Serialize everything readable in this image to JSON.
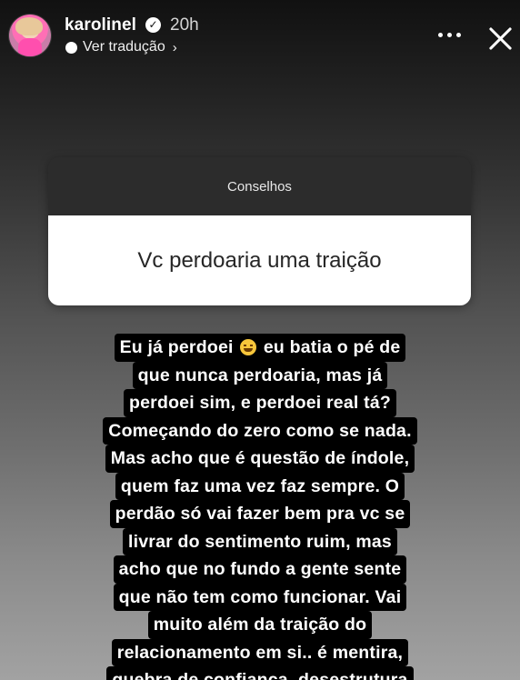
{
  "header": {
    "username": "karolinel",
    "time": "20h",
    "translate_label": "Ver tradução",
    "verified_glyph": "✓",
    "chevron_glyph": "›"
  },
  "question_sticker": {
    "title": "Conselhos",
    "question": "Vc perdoaria uma traição"
  },
  "answer": {
    "line1_before_emoji": "Eu já perdoei",
    "emoji_icon": "grinning-sweat-emoji",
    "line1_after_emoji": "eu batia o pé de",
    "lines": [
      "que nunca perdoaria, mas já",
      "perdoei sim, e perdoei real tá?",
      "Começando do zero como se nada.",
      "Mas acho que é questão de índole,",
      "quem faz uma vez faz sempre. O",
      "perdão só vai fazer bem pra vc se",
      "livrar do sentimento ruim, mas",
      "acho que no fundo a gente sente",
      "que não tem como funcionar. Vai",
      "muito além da traição do",
      "relacionamento em si.. é mentira,",
      "quebra de confiança, desestrutura"
    ]
  },
  "icons": {
    "more": "more-horizontal-icon",
    "close": "close-icon",
    "globe": "globe-icon"
  },
  "colors": {
    "answer_highlight": "#000000",
    "sticker_header": "#2c2c2c",
    "sticker_body": "#ffffff"
  }
}
